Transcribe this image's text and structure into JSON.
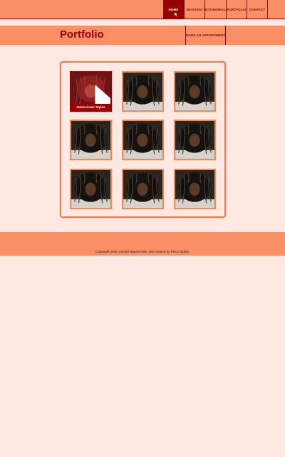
{
  "nav": {
    "items": [
      {
        "label": "HOME",
        "active": true
      },
      {
        "label": "BOOKING",
        "active": false
      },
      {
        "label": "TESTIMONIALS",
        "active": false
      },
      {
        "label": "PORTFOLIO",
        "active": false
      },
      {
        "label": "CONTACT",
        "active": false
      }
    ]
  },
  "header": {
    "title": "Portfolio",
    "book_label": "BOOK AN APPOINTMENT"
  },
  "gallery": {
    "featured_caption": "Natural Hair Styles",
    "tile_count": 9
  },
  "footer": {
    "copyright": "Copyright 2015, merahi Natural Hair. Site created by Piece Digital."
  },
  "colors": {
    "background": "#fde9e1",
    "band": "#fa8f66",
    "accent": "#990000",
    "tile_border": "#f08a5d"
  }
}
